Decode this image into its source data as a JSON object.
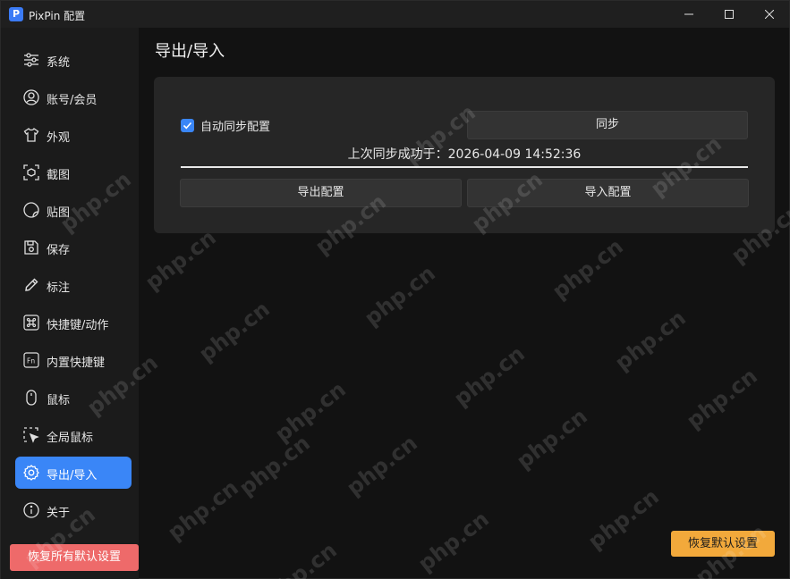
{
  "window": {
    "title": "PixPin 配置",
    "app_icon_letter": "P"
  },
  "sidebar": {
    "items": [
      {
        "label": "系统",
        "icon": "sliders-icon"
      },
      {
        "label": "账号/会员",
        "icon": "user-icon"
      },
      {
        "label": "外观",
        "icon": "shirt-icon"
      },
      {
        "label": "截图",
        "icon": "screenshot-icon"
      },
      {
        "label": "贴图",
        "icon": "sticker-icon"
      },
      {
        "label": "保存",
        "icon": "save-icon"
      },
      {
        "label": "标注",
        "icon": "pencil-icon"
      },
      {
        "label": "快捷键/动作",
        "icon": "command-icon"
      },
      {
        "label": "内置快捷键",
        "icon": "fn-key-icon"
      },
      {
        "label": "鼠标",
        "icon": "mouse-icon"
      },
      {
        "label": "全局鼠标",
        "icon": "cursor-select-icon"
      },
      {
        "label": "导出/导入",
        "icon": "gear-icon"
      },
      {
        "label": "关于",
        "icon": "info-icon"
      }
    ],
    "active_index": 11,
    "reset_all_label": "恢复所有默认设置"
  },
  "main": {
    "title": "导出/导入",
    "auto_sync_label": "自动同步配置",
    "auto_sync_checked": true,
    "sync_button_label": "同步",
    "sync_status": "上次同步成功于：2026-04-09 14:52:36",
    "export_button_label": "导出配置",
    "import_button_label": "导入配置",
    "reset_defaults_label": "恢复默认设置"
  },
  "watermark": {
    "text": "php.cn"
  },
  "colors": {
    "accent": "#3a86f7",
    "danger": "#ee6a6a",
    "warning": "#f2a93b"
  }
}
